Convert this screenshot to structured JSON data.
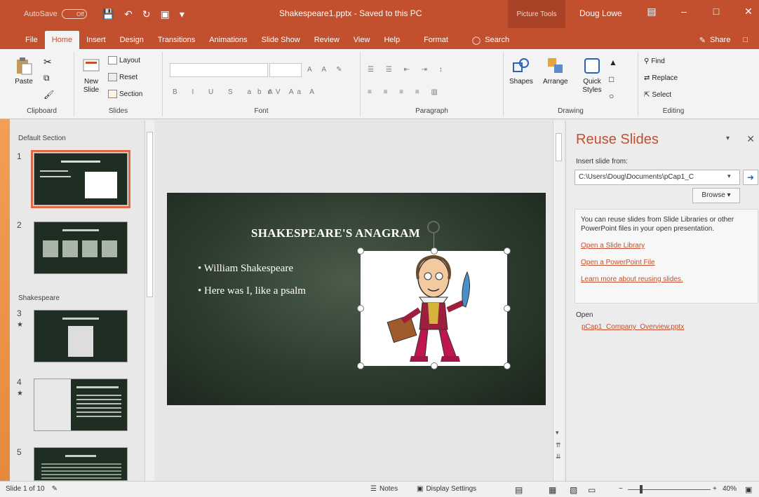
{
  "titlebar": {
    "autosave_label": "AutoSave",
    "autosave_state": "Off",
    "doc_title": "Shakespeare1.pptx  -  Saved to this PC",
    "context_tab": "Picture Tools",
    "user": "Doug Lowe"
  },
  "tabs": [
    {
      "label": "File"
    },
    {
      "label": "Home"
    },
    {
      "label": "Insert"
    },
    {
      "label": "Design"
    },
    {
      "label": "Transitions"
    },
    {
      "label": "Animations"
    },
    {
      "label": "Slide Show"
    },
    {
      "label": "Review"
    },
    {
      "label": "View"
    },
    {
      "label": "Help"
    },
    {
      "label": "Format"
    }
  ],
  "search_label": "Search",
  "share_label": "Share",
  "ribbon": {
    "clipboard": {
      "paste": "Paste",
      "group": "Clipboard"
    },
    "slides": {
      "new_slide": "New Slide",
      "layout": "Layout",
      "reset": "Reset",
      "section": "Section",
      "group": "Slides"
    },
    "font": {
      "group": "Font"
    },
    "paragraph": {
      "group": "Paragraph"
    },
    "drawing": {
      "shapes": "Shapes",
      "arrange": "Arrange",
      "quick_styles": "Quick Styles",
      "group": "Drawing"
    },
    "editing": {
      "find": "Find",
      "replace": "Replace",
      "select": "Select",
      "group": "Editing"
    }
  },
  "slidepane": {
    "section_default": "Default Section",
    "section_shakespeare": "Shakespeare",
    "thumbs": [
      {
        "num": "1",
        "star": ""
      },
      {
        "num": "2",
        "star": ""
      },
      {
        "num": "3",
        "star": "★"
      },
      {
        "num": "4",
        "star": "★"
      },
      {
        "num": "5",
        "star": ""
      }
    ]
  },
  "slide": {
    "title": "SHAKESPEARE'S ANAGRAM",
    "bullets": [
      "• William Shakespeare",
      "• Here was I, like a psalm"
    ]
  },
  "reuse": {
    "title": "Reuse Slides",
    "insert_label": "Insert slide from:",
    "path": "C:\\Users\\Doug\\Documents\\pCap1_C",
    "browse": "Browse",
    "info_text": "You can reuse slides from Slide Libraries or other PowerPoint files in your open presentation.",
    "link_library": "Open a Slide Library",
    "link_file": "Open a PowerPoint File",
    "link_learn": "Learn more about reusing slides.",
    "open_label": "Open",
    "open_file": "pCap1_Company_Overview.pptx"
  },
  "status": {
    "slide_info": "Slide 1 of 10",
    "notes": "Notes",
    "display_settings": "Display Settings",
    "zoom": "40%"
  },
  "colors": {
    "accent": "#c24f2d",
    "slide_bg": "#2d3b2e"
  }
}
